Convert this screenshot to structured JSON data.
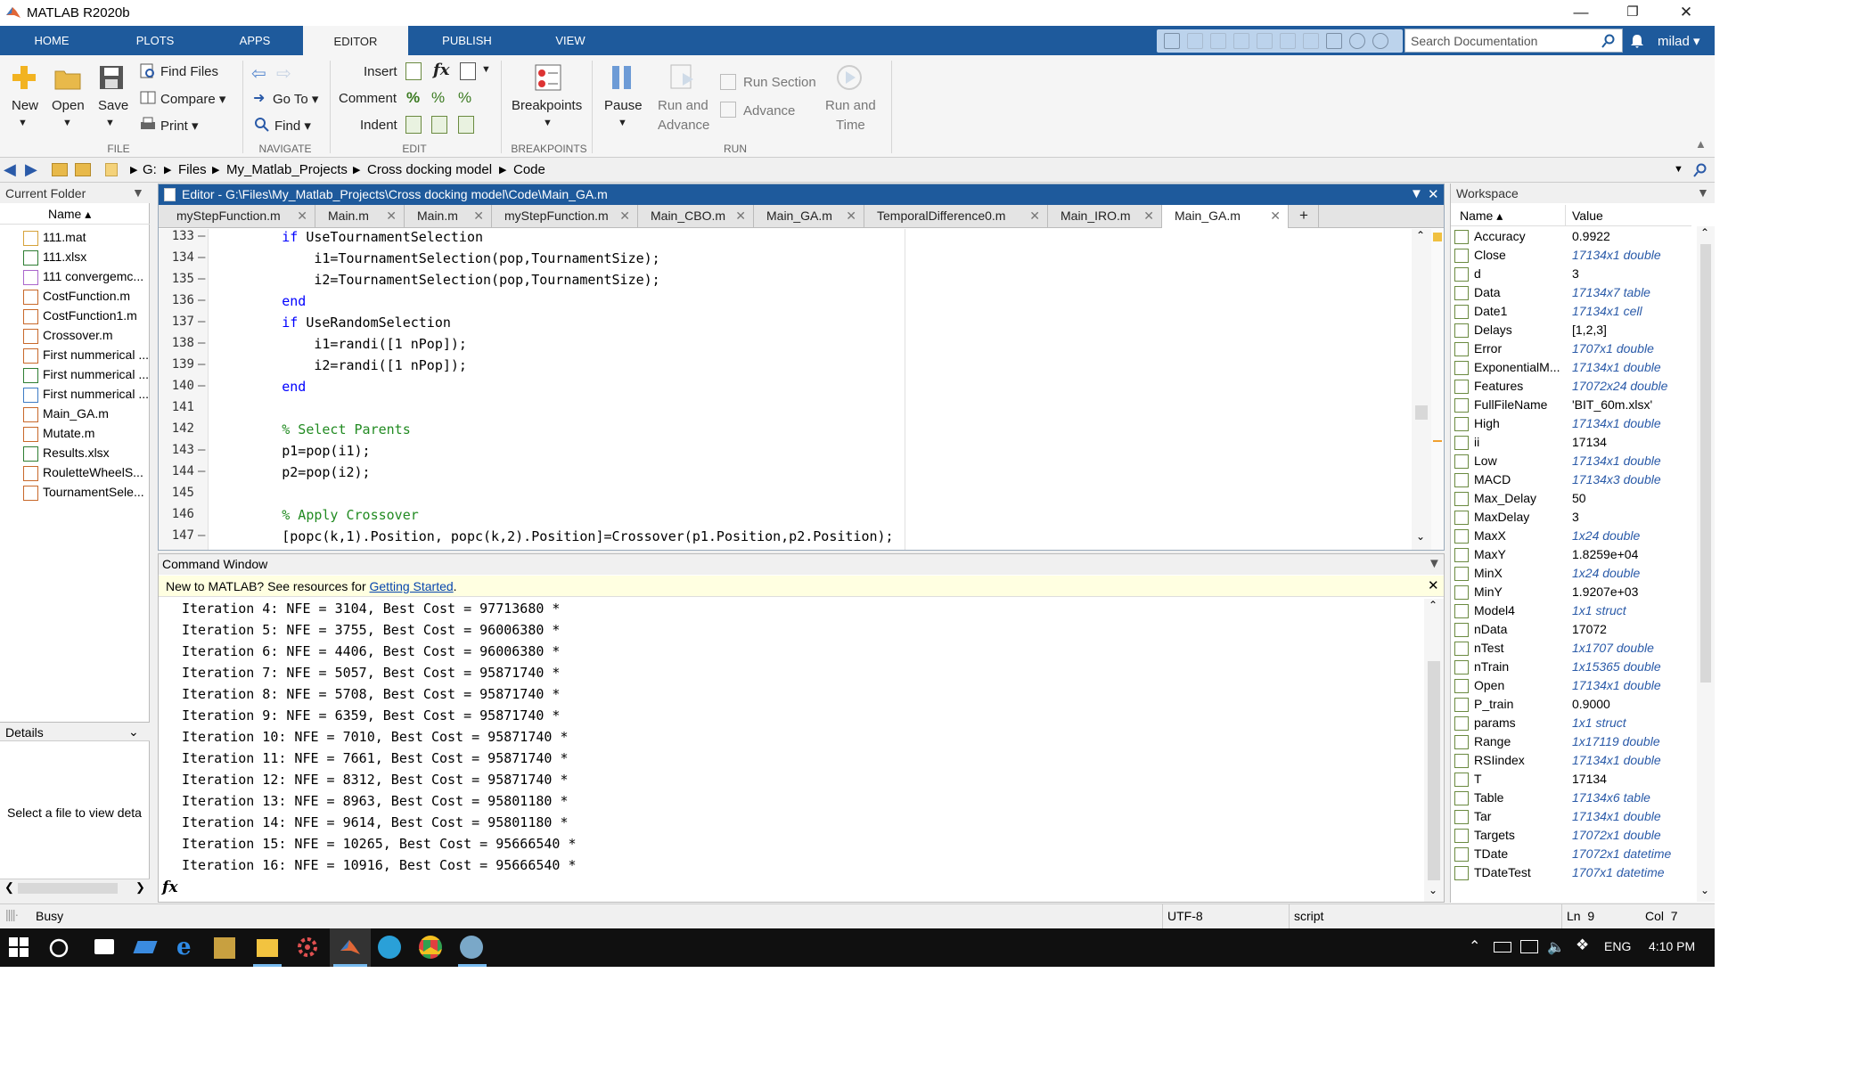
{
  "window": {
    "title": "MATLAB R2020b"
  },
  "ribbon_tabs": [
    "HOME",
    "PLOTS",
    "APPS",
    "EDITOR",
    "PUBLISH",
    "VIEW"
  ],
  "search_placeholder": "Search Documentation",
  "user": "milad ▾",
  "ribbon": {
    "file": {
      "new": "New",
      "open": "Open",
      "save": "Save",
      "find_files": "Find Files",
      "compare": "Compare ▾",
      "print": "Print ▾",
      "group": "FILE"
    },
    "navigate": {
      "go_to": "Go To ▾",
      "find": "Find ▾",
      "group": "NAVIGATE"
    },
    "edit": {
      "insert": "Insert",
      "comment": "Comment",
      "indent": "Indent",
      "group": "EDIT"
    },
    "breakpoints": {
      "label": "Breakpoints",
      "group": "BREAKPOINTS"
    },
    "run": {
      "pause": "Pause",
      "run_and_advance_1": "Run and",
      "run_and_advance_2": "Advance",
      "run_section": "Run Section",
      "advance": "Advance",
      "run_and_time_1": "Run and",
      "run_and_time_2": "Time",
      "group": "RUN"
    }
  },
  "path": [
    "G:",
    "Files",
    "My_Matlab_Projects",
    "Cross docking model",
    "Code"
  ],
  "current_folder": {
    "title": "Current Folder",
    "name_col": "Name ▴",
    "files": [
      "111.mat",
      "111.xlsx",
      "111 convergemc...",
      "CostFunction.m",
      "CostFunction1.m",
      "Crossover.m",
      "First nummerical ...",
      "First nummerical ...",
      "First nummerical ...",
      "Main_GA.m",
      "Mutate.m",
      "Results.xlsx",
      "RouletteWheelS...",
      "TournamentSele..."
    ],
    "details_title": "Details",
    "details_text": "Select a file to view deta"
  },
  "editor": {
    "title": "Editor - G:\\Files\\My_Matlab_Projects\\Cross docking model\\Code\\Main_GA.m",
    "tabs": [
      "myStepFunction.m",
      "Main.m",
      "Main.m",
      "myStepFunction.m",
      "Main_CBO.m",
      "Main_GA.m",
      "TemporalDifference0.m",
      "Main_IRO.m",
      "Main_GA.m"
    ],
    "lines": [
      {
        "num": "133",
        "dash": "–",
        "code": "        if UseTournamentSelection"
      },
      {
        "num": "134",
        "dash": "–",
        "code": "            i1=TournamentSelection(pop,TournamentSize);"
      },
      {
        "num": "135",
        "dash": "–",
        "code": "            i2=TournamentSelection(pop,TournamentSize);"
      },
      {
        "num": "136",
        "dash": "–",
        "code": "        end"
      },
      {
        "num": "137",
        "dash": "–",
        "code": "        if UseRandomSelection"
      },
      {
        "num": "138",
        "dash": "–",
        "code": "            i1=randi([1 nPop]);"
      },
      {
        "num": "139",
        "dash": "–",
        "code": "            i2=randi([1 nPop]);"
      },
      {
        "num": "140",
        "dash": "–",
        "code": "        end"
      },
      {
        "num": "141",
        "dash": "",
        "code": ""
      },
      {
        "num": "142",
        "dash": "",
        "code": "        % Select Parents"
      },
      {
        "num": "143",
        "dash": "–",
        "code": "        p1=pop(i1);"
      },
      {
        "num": "144",
        "dash": "–",
        "code": "        p2=pop(i2);"
      },
      {
        "num": "145",
        "dash": "",
        "code": ""
      },
      {
        "num": "146",
        "dash": "",
        "code": "        % Apply Crossover"
      },
      {
        "num": "147",
        "dash": "–",
        "code": "        [popc(k,1).Position, popc(k,2).Position]=Crossover(p1.Position,p2.Position);"
      }
    ]
  },
  "command_window": {
    "title": "Command Window",
    "banner_prefix": "New to MATLAB? See resources for ",
    "banner_link": "Getting Started",
    "banner_suffix": ".",
    "lines": [
      "Iteration 4: NFE = 3104, Best Cost = 97713680 *",
      "Iteration 5: NFE = 3755, Best Cost = 96006380 *",
      "Iteration 6: NFE = 4406, Best Cost = 96006380 *",
      "Iteration 7: NFE = 5057, Best Cost = 95871740 *",
      "Iteration 8: NFE = 5708, Best Cost = 95871740 *",
      "Iteration 9: NFE = 6359, Best Cost = 95871740 *",
      "Iteration 10: NFE = 7010, Best Cost = 95871740 *",
      "Iteration 11: NFE = 7661, Best Cost = 95871740 *",
      "Iteration 12: NFE = 8312, Best Cost = 95871740 *",
      "Iteration 13: NFE = 8963, Best Cost = 95801180 *",
      "Iteration 14: NFE = 9614, Best Cost = 95801180 *",
      "Iteration 15: NFE = 10265, Best Cost = 95666540 *",
      "Iteration 16: NFE = 10916, Best Cost = 95666540 *"
    ],
    "prompt": "fx"
  },
  "workspace": {
    "title": "Workspace",
    "name_col": "Name ▴",
    "value_col": "Value",
    "vars": [
      {
        "name": "Accuracy",
        "value": "0.9922",
        "italic": false
      },
      {
        "name": "Close",
        "value": "17134x1 double",
        "italic": true
      },
      {
        "name": "d",
        "value": "3",
        "italic": false
      },
      {
        "name": "Data",
        "value": "17134x7 table",
        "italic": true
      },
      {
        "name": "Date1",
        "value": "17134x1 cell",
        "italic": true
      },
      {
        "name": "Delays",
        "value": "[1,2,3]",
        "italic": false
      },
      {
        "name": "Error",
        "value": "1707x1 double",
        "italic": true
      },
      {
        "name": "ExponentialM...",
        "value": "17134x1 double",
        "italic": true
      },
      {
        "name": "Features",
        "value": "17072x24 double",
        "italic": true
      },
      {
        "name": "FullFileName",
        "value": "'BIT_60m.xlsx'",
        "italic": false
      },
      {
        "name": "High",
        "value": "17134x1 double",
        "italic": true
      },
      {
        "name": "ii",
        "value": "17134",
        "italic": false
      },
      {
        "name": "Low",
        "value": "17134x1 double",
        "italic": true
      },
      {
        "name": "MACD",
        "value": "17134x3 double",
        "italic": true
      },
      {
        "name": "Max_Delay",
        "value": "50",
        "italic": false
      },
      {
        "name": "MaxDelay",
        "value": "3",
        "italic": false
      },
      {
        "name": "MaxX",
        "value": "1x24 double",
        "italic": true
      },
      {
        "name": "MaxY",
        "value": "1.8259e+04",
        "italic": false
      },
      {
        "name": "MinX",
        "value": "1x24 double",
        "italic": true
      },
      {
        "name": "MinY",
        "value": "1.9207e+03",
        "italic": false
      },
      {
        "name": "Model4",
        "value": "1x1 struct",
        "italic": true
      },
      {
        "name": "nData",
        "value": "17072",
        "italic": false
      },
      {
        "name": "nTest",
        "value": "1x1707 double",
        "italic": true
      },
      {
        "name": "nTrain",
        "value": "1x15365 double",
        "italic": true
      },
      {
        "name": "Open",
        "value": "17134x1 double",
        "italic": true
      },
      {
        "name": "P_train",
        "value": "0.9000",
        "italic": false
      },
      {
        "name": "params",
        "value": "1x1 struct",
        "italic": true
      },
      {
        "name": "Range",
        "value": "1x17119 double",
        "italic": true
      },
      {
        "name": "RSIindex",
        "value": "17134x1 double",
        "italic": true
      },
      {
        "name": "T",
        "value": "17134",
        "italic": false
      },
      {
        "name": "Table",
        "value": "17134x6 table",
        "italic": true
      },
      {
        "name": "Tar",
        "value": "17134x1 double",
        "italic": true
      },
      {
        "name": "Targets",
        "value": "17072x1 double",
        "italic": true
      },
      {
        "name": "TDate",
        "value": "17072x1 datetime",
        "italic": true
      },
      {
        "name": "TDateTest",
        "value": "1707x1 datetime",
        "italic": true
      }
    ]
  },
  "status": {
    "state": "Busy",
    "encoding": "UTF-8",
    "type": "script",
    "ln": "Ln  9",
    "col": "Col  7"
  },
  "taskbar": {
    "lang": "ENG",
    "time": "4:10 PM"
  }
}
